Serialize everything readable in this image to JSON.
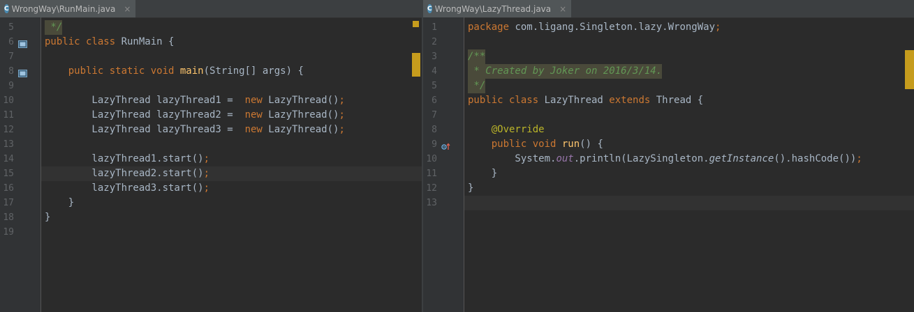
{
  "left": {
    "tab": {
      "icon": "java-class-icon",
      "label": "WrongWay\\RunMain.java",
      "close": "×"
    },
    "lines": [
      {
        "n": "5",
        "t": [
          [
            "cm",
            " */"
          ]
        ],
        "cm": true
      },
      {
        "n": "6",
        "t": [
          [
            "kw",
            "public class "
          ],
          [
            "",
            "RunMain {"
          ]
        ],
        "icon": "run-icon"
      },
      {
        "n": "7",
        "t": []
      },
      {
        "n": "8",
        "t": [
          [
            "",
            "    "
          ],
          [
            "kw",
            "public static void "
          ],
          [
            "fn",
            "main"
          ],
          [
            "",
            "(String[] args) {"
          ]
        ],
        "icon": "run-icon"
      },
      {
        "n": "9",
        "t": []
      },
      {
        "n": "10",
        "t": [
          [
            "",
            "        LazyThread lazyThread1 =  "
          ],
          [
            "kw",
            "new "
          ],
          [
            "",
            "LazyThread()"
          ],
          [
            "kw",
            ";"
          ]
        ]
      },
      {
        "n": "11",
        "t": [
          [
            "",
            "        LazyThread lazyThread2 =  "
          ],
          [
            "kw",
            "new "
          ],
          [
            "",
            "LazyThread()"
          ],
          [
            "kw",
            ";"
          ]
        ]
      },
      {
        "n": "12",
        "t": [
          [
            "",
            "        LazyThread lazyThread3 =  "
          ],
          [
            "kw",
            "new "
          ],
          [
            "",
            "LazyThread()"
          ],
          [
            "kw",
            ";"
          ]
        ]
      },
      {
        "n": "13",
        "t": []
      },
      {
        "n": "14",
        "t": [
          [
            "",
            "        lazyThread1.start()"
          ],
          [
            "kw",
            ";"
          ]
        ]
      },
      {
        "n": "15",
        "t": [
          [
            "",
            "        lazyThread2.start()"
          ],
          [
            "kw",
            ";"
          ]
        ],
        "current": true
      },
      {
        "n": "16",
        "t": [
          [
            "",
            "        lazyThread3.start()"
          ],
          [
            "kw",
            ";"
          ]
        ]
      },
      {
        "n": "17",
        "t": [
          [
            "",
            "    }"
          ]
        ]
      },
      {
        "n": "18",
        "t": [
          [
            "",
            "}"
          ]
        ]
      },
      {
        "n": "19",
        "t": []
      }
    ]
  },
  "right": {
    "tab": {
      "icon": "java-class-icon",
      "label": "WrongWay\\LazyThread.java",
      "close": "×"
    },
    "lines": [
      {
        "n": "1",
        "t": [
          [
            "kw",
            "package "
          ],
          [
            "",
            "com.ligang.Singleton.lazy.WrongWay"
          ],
          [
            "kw",
            ";"
          ]
        ]
      },
      {
        "n": "2",
        "t": []
      },
      {
        "n": "3",
        "t": [
          [
            "cm",
            "/**"
          ]
        ],
        "cm": true
      },
      {
        "n": "4",
        "t": [
          [
            "cm",
            " * Created by Joker on 2016/3/14."
          ]
        ],
        "cm": true
      },
      {
        "n": "5",
        "t": [
          [
            "cm",
            " */"
          ]
        ],
        "cm": true
      },
      {
        "n": "6",
        "t": [
          [
            "kw",
            "public class "
          ],
          [
            "",
            "LazyThread "
          ],
          [
            "kw",
            "extends "
          ],
          [
            "",
            "Thread {"
          ]
        ]
      },
      {
        "n": "7",
        "t": []
      },
      {
        "n": "8",
        "t": [
          [
            "",
            "    "
          ],
          [
            "ann",
            "@Override"
          ]
        ]
      },
      {
        "n": "9",
        "t": [
          [
            "",
            "    "
          ],
          [
            "kw",
            "public void "
          ],
          [
            "fn",
            "run"
          ],
          [
            "",
            "() {"
          ]
        ],
        "icon": "override-icon"
      },
      {
        "n": "10",
        "t": [
          [
            "",
            "        System."
          ],
          [
            "fld",
            "out"
          ],
          [
            "",
            ".println(LazySingleton."
          ],
          [
            "sm",
            "getInstance"
          ],
          [
            "",
            "().hashCode())"
          ],
          [
            "kw",
            ";"
          ]
        ]
      },
      {
        "n": "11",
        "t": [
          [
            "",
            "    }"
          ]
        ]
      },
      {
        "n": "12",
        "t": [
          [
            "",
            "}"
          ]
        ]
      },
      {
        "n": "13",
        "t": [],
        "current": true
      }
    ]
  }
}
